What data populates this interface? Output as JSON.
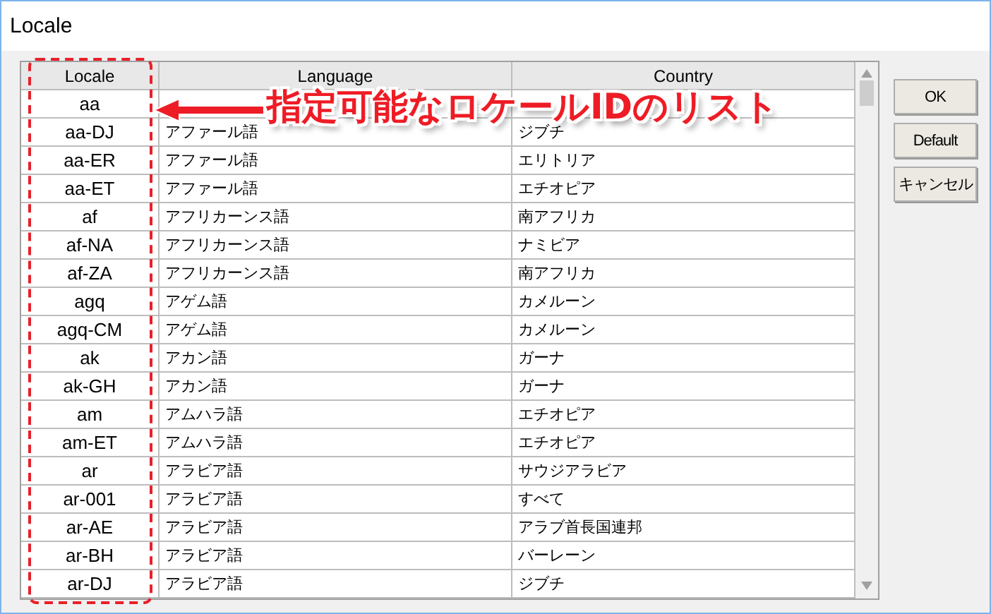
{
  "window": {
    "title": "Locale"
  },
  "table": {
    "columns": [
      "Locale",
      "Language",
      "Country"
    ],
    "rows": [
      {
        "locale": "aa"
      },
      {
        "locale": "aa-DJ",
        "language": "アファール語",
        "country": "ジブチ"
      },
      {
        "locale": "aa-ER",
        "language": "アファール語",
        "country": "エリトリア"
      },
      {
        "locale": "aa-ET",
        "language": "アファール語",
        "country": "エチオピア"
      },
      {
        "locale": "af",
        "language": "アフリカーンス語",
        "country": "南アフリカ"
      },
      {
        "locale": "af-NA",
        "language": "アフリカーンス語",
        "country": "ナミビア"
      },
      {
        "locale": "af-ZA",
        "language": "アフリカーンス語",
        "country": "南アフリカ"
      },
      {
        "locale": "agq",
        "language": "アゲム語",
        "country": "カメルーン"
      },
      {
        "locale": "agq-CM",
        "language": "アゲム語",
        "country": "カメルーン"
      },
      {
        "locale": "ak",
        "language": "アカン語",
        "country": "ガーナ"
      },
      {
        "locale": "ak-GH",
        "language": "アカン語",
        "country": "ガーナ"
      },
      {
        "locale": "am",
        "language": "アムハラ語",
        "country": "エチオピア"
      },
      {
        "locale": "am-ET",
        "language": "アムハラ語",
        "country": "エチオピア"
      },
      {
        "locale": "ar",
        "language": "アラビア語",
        "country": "サウジアラビア"
      },
      {
        "locale": "ar-001",
        "language": "アラビア語",
        "country": "すべて"
      },
      {
        "locale": "ar-AE",
        "language": "アラビア語",
        "country": "アラブ首長国連邦"
      },
      {
        "locale": "ar-BH",
        "language": "アラビア語",
        "country": "バーレーン"
      },
      {
        "locale": "ar-DJ",
        "language": "アラビア語",
        "country": "ジブチ"
      }
    ]
  },
  "buttons": [
    "OK",
    "Default",
    "キャンセル"
  ],
  "annotation": {
    "text": "指定可能なロケールIDのリスト"
  }
}
